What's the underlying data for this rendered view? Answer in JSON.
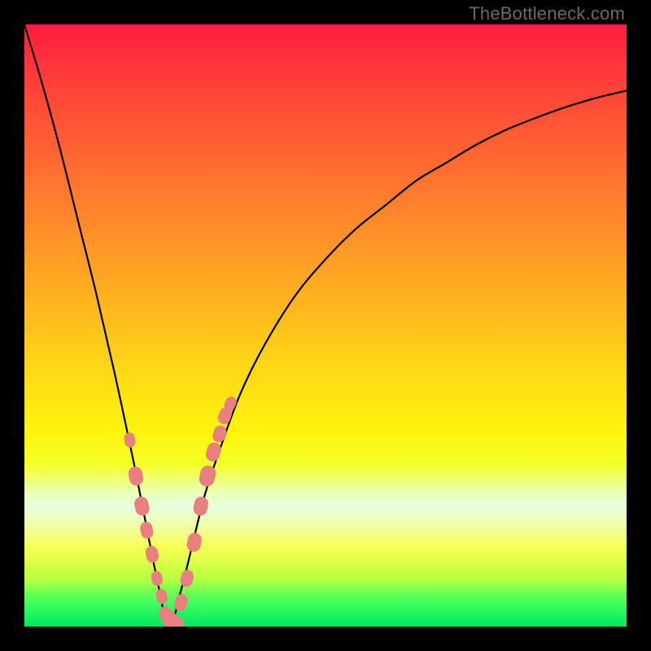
{
  "watermark": "TheBottleneck.com",
  "colors": {
    "frame_bg": "#000000",
    "marker_fill": "#e98080",
    "curve_stroke": "#000000",
    "gradient_top": "#ff1a40",
    "gradient_bottom": "#00e860"
  },
  "chart_data": {
    "type": "line",
    "title": "",
    "xlabel": "",
    "ylabel": "",
    "xlim": [
      0,
      100
    ],
    "ylim": [
      0,
      100
    ],
    "grid": false,
    "x_min_at": 24,
    "series": [
      {
        "name": "bottleneck-curve",
        "x": [
          0,
          3,
          6,
          9,
          12,
          15,
          18,
          20,
          22,
          24,
          26,
          28,
          30,
          33,
          36,
          40,
          45,
          50,
          55,
          60,
          65,
          70,
          75,
          80,
          85,
          90,
          95,
          100
        ],
        "y": [
          100,
          90,
          79,
          67,
          55,
          42,
          28,
          18,
          8,
          0,
          6,
          14,
          22,
          31,
          39,
          47,
          55,
          61,
          66,
          70,
          74,
          77,
          80,
          82.5,
          84.5,
          86.3,
          87.8,
          89
        ]
      }
    ],
    "markers": {
      "x": [
        17.5,
        18.5,
        19.5,
        20.3,
        21.2,
        22.0,
        22.8,
        23.5,
        24.3,
        25.0,
        26.0,
        27.0,
        28.2,
        29.3,
        30.4,
        31.4,
        32.4,
        33.3,
        34.2
      ],
      "y": [
        31,
        25,
        20,
        16,
        12,
        8,
        5,
        2,
        1,
        0,
        4,
        8,
        14,
        20,
        25,
        29,
        32,
        35,
        37
      ],
      "radius": [
        7,
        9,
        9,
        8,
        8,
        7,
        7,
        8,
        10,
        10,
        8,
        8,
        9,
        9,
        10,
        9,
        8,
        8,
        7
      ]
    }
  }
}
